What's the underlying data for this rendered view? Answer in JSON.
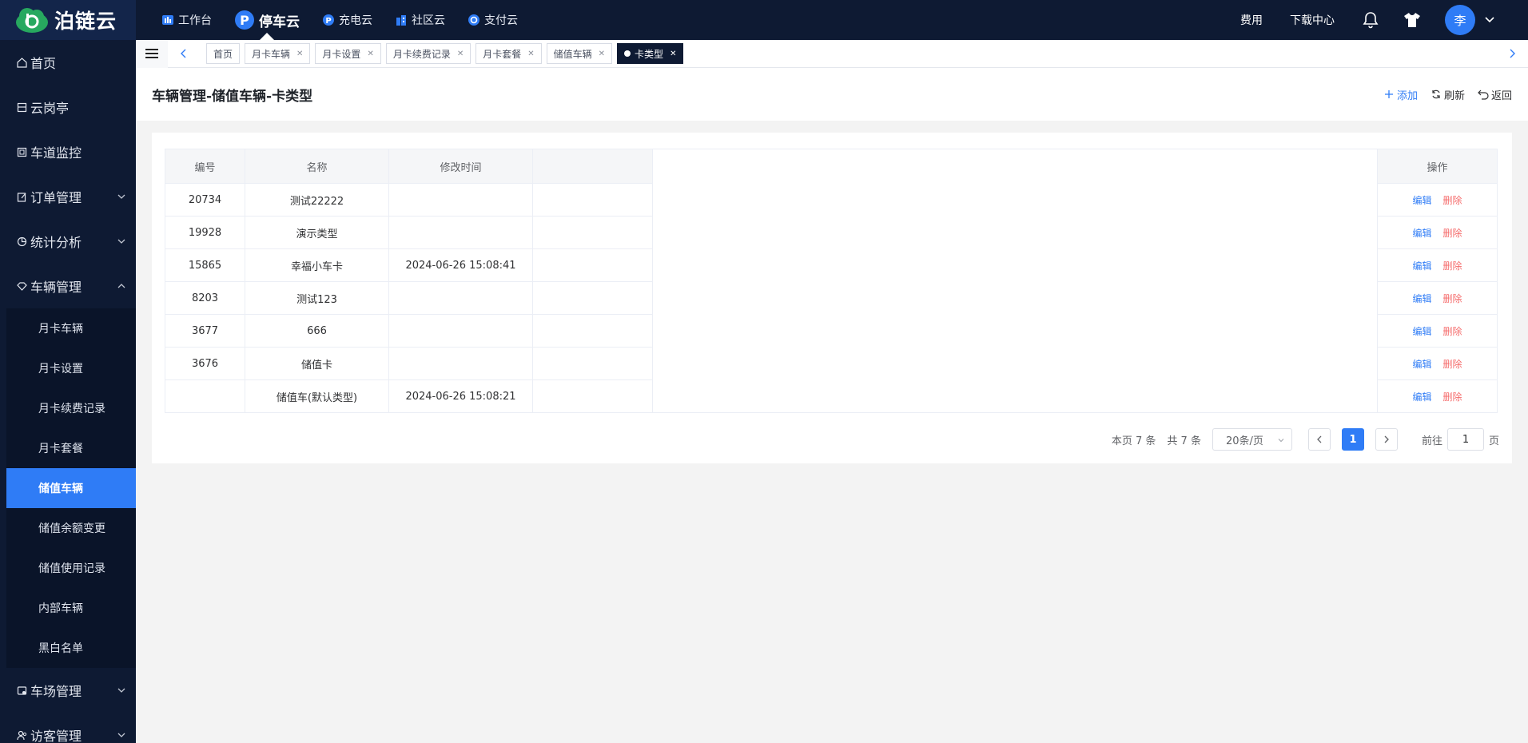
{
  "app": {
    "logo_text": "泊链云"
  },
  "topnav": [
    {
      "label": "工作台",
      "icon": "chart-icon"
    },
    {
      "label": "停车云",
      "icon": "parking-icon",
      "active": true
    },
    {
      "label": "充电云",
      "icon": "charging-icon"
    },
    {
      "label": "社区云",
      "icon": "community-icon"
    },
    {
      "label": "支付云",
      "icon": "payment-icon"
    }
  ],
  "topright": {
    "fee": "费用",
    "download": "下载中心",
    "avatar": "李"
  },
  "sidebar": {
    "items": [
      {
        "label": "首页"
      },
      {
        "label": "云岗亭"
      },
      {
        "label": "车道监控"
      },
      {
        "label": "订单管理"
      },
      {
        "label": "统计分析"
      },
      {
        "label": "车辆管理"
      },
      {
        "label": "车场管理"
      },
      {
        "label": "访客管理"
      }
    ],
    "sub": [
      "月卡车辆",
      "月卡设置",
      "月卡续费记录",
      "月卡套餐",
      "储值车辆",
      "储值余额变更",
      "储值使用记录",
      "内部车辆",
      "黑白名单"
    ]
  },
  "tabs": [
    {
      "label": "首页",
      "closable": false
    },
    {
      "label": "月卡车辆",
      "closable": true
    },
    {
      "label": "月卡设置",
      "closable": true
    },
    {
      "label": "月卡续费记录",
      "closable": true
    },
    {
      "label": "月卡套餐",
      "closable": true
    },
    {
      "label": "储值车辆",
      "closable": true
    },
    {
      "label": "卡类型",
      "closable": true,
      "active": true
    }
  ],
  "page": {
    "title": "车辆管理-储值车辆-卡类型",
    "add": "添加",
    "refresh": "刷新",
    "back": "返回"
  },
  "table": {
    "headers": {
      "id": "编号",
      "name": "名称",
      "mtime": "修改时间",
      "ops": "操作"
    },
    "edit_label": "编辑",
    "delete_label": "删除",
    "rows": [
      {
        "id": "20734",
        "name": "测试22222",
        "mtime": ""
      },
      {
        "id": "19928",
        "name": "演示类型",
        "mtime": ""
      },
      {
        "id": "15865",
        "name": "幸福小车卡",
        "mtime": "2024-06-26 15:08:41"
      },
      {
        "id": "8203",
        "name": "测试123",
        "mtime": ""
      },
      {
        "id": "3677",
        "name": "666",
        "mtime": ""
      },
      {
        "id": "3676",
        "name": "储值卡",
        "mtime": ""
      },
      {
        "id": "",
        "name": "储值车(默认类型)",
        "mtime": "2024-06-26 15:08:21"
      }
    ]
  },
  "pager": {
    "page_count": "本页 7 条",
    "total": "共 7 条",
    "size": "20条/页",
    "current": "1",
    "goto_label": "前往",
    "goto_value": "1",
    "page_unit": "页"
  },
  "colors": {
    "primary": "#2f7cf6",
    "dark": "#0e1a33",
    "danger": "#f56c6c"
  }
}
